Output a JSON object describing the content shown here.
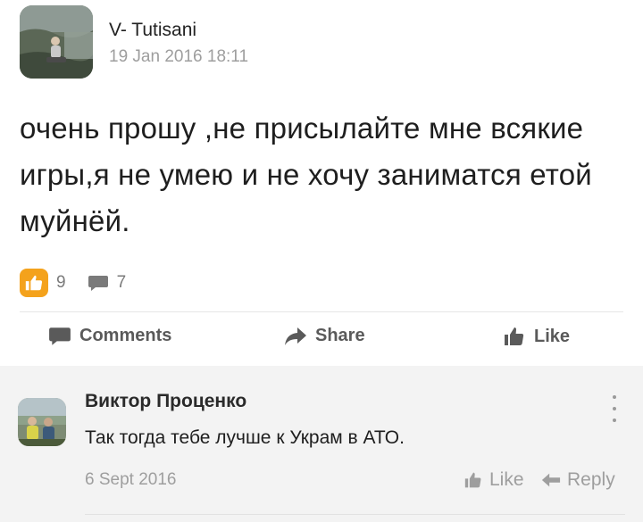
{
  "post": {
    "author": "V- Tutisani",
    "date": "19 Jan 2016 18:11",
    "text": "очень прошу ,не присылайте мне всякие игры,я не умею и не хочу заниматся етой муйнёй.",
    "likes_count": "9",
    "comments_count": "7"
  },
  "actions": {
    "comments_label": "Comments",
    "share_label": "Share",
    "like_label": "Like"
  },
  "comment": {
    "author": "Виктор Проценко",
    "text": "Так тогда тебе лучше к Украм в АТО.",
    "date": "6 Sept 2016",
    "like_label": "Like",
    "reply_label": "Reply"
  },
  "colors": {
    "like_badge": "#f4a21c",
    "action_text": "#5a5a5a",
    "muted_text": "#9e9e9e",
    "comment_bg": "#f3f3f3"
  },
  "icons": {
    "like_badge": "thumbs-up-icon",
    "comment_count": "speech-bubble-icon",
    "comments_action": "speech-bubble-icon",
    "share_action": "share-arrow-icon",
    "like_action": "thumbs-up-icon",
    "comment_like": "thumbs-up-icon",
    "comment_reply": "reply-arrow-icon",
    "comment_menu": "more-vertical-icon"
  }
}
